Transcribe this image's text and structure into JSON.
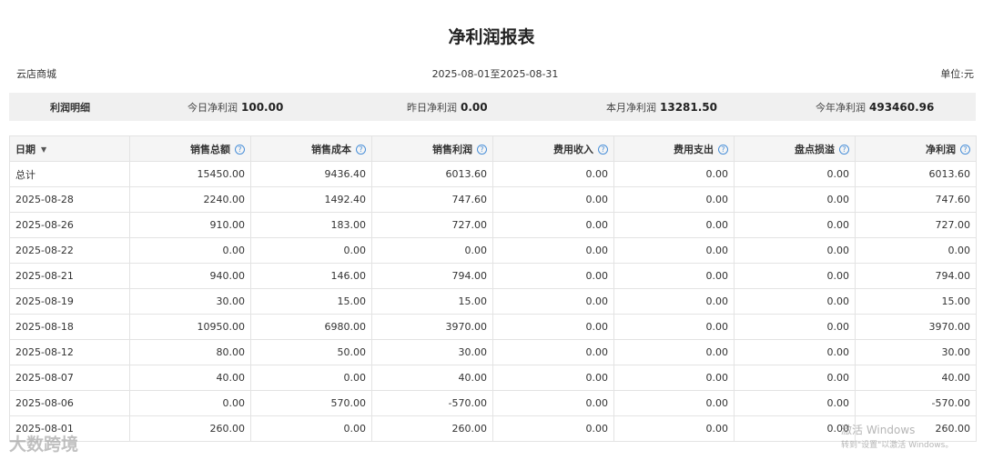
{
  "report": {
    "title": "净利润报表",
    "store": "云店商城",
    "date_range": "2025-08-01至2025-08-31",
    "unit": "单位:元"
  },
  "summary": {
    "label": "利润明细",
    "today_label": "今日净利润",
    "today_value": "100.00",
    "yesterday_label": "昨日净利润",
    "yesterday_value": "0.00",
    "month_label": "本月净利润",
    "month_value": "13281.50",
    "year_label": "今年净利润",
    "year_value": "493460.96"
  },
  "table": {
    "headers": [
      "日期",
      "销售总额",
      "销售成本",
      "销售利润",
      "费用收入",
      "费用支出",
      "盘点损溢",
      "净利润"
    ],
    "help_icon": "question-circle-icon",
    "sort_icon": "caret-down-icon",
    "rows": [
      [
        "总计",
        "15450.00",
        "9436.40",
        "6013.60",
        "0.00",
        "0.00",
        "0.00",
        "6013.60"
      ],
      [
        "2025-08-28",
        "2240.00",
        "1492.40",
        "747.60",
        "0.00",
        "0.00",
        "0.00",
        "747.60"
      ],
      [
        "2025-08-26",
        "910.00",
        "183.00",
        "727.00",
        "0.00",
        "0.00",
        "0.00",
        "727.00"
      ],
      [
        "2025-08-22",
        "0.00",
        "0.00",
        "0.00",
        "0.00",
        "0.00",
        "0.00",
        "0.00"
      ],
      [
        "2025-08-21",
        "940.00",
        "146.00",
        "794.00",
        "0.00",
        "0.00",
        "0.00",
        "794.00"
      ],
      [
        "2025-08-19",
        "30.00",
        "15.00",
        "15.00",
        "0.00",
        "0.00",
        "0.00",
        "15.00"
      ],
      [
        "2025-08-18",
        "10950.00",
        "6980.00",
        "3970.00",
        "0.00",
        "0.00",
        "0.00",
        "3970.00"
      ],
      [
        "2025-08-12",
        "80.00",
        "50.00",
        "30.00",
        "0.00",
        "0.00",
        "0.00",
        "30.00"
      ],
      [
        "2025-08-07",
        "40.00",
        "0.00",
        "40.00",
        "0.00",
        "0.00",
        "0.00",
        "40.00"
      ],
      [
        "2025-08-06",
        "0.00",
        "570.00",
        "-570.00",
        "0.00",
        "0.00",
        "0.00",
        "-570.00"
      ],
      [
        "2025-08-01",
        "260.00",
        "0.00",
        "260.00",
        "0.00",
        "0.00",
        "0.00",
        "260.00"
      ]
    ]
  },
  "watermarks": {
    "logo_text": "大数跨境",
    "windows_activate": "激活 Windows",
    "windows_hint": "转到\"设置\"以激活 Windows。"
  }
}
